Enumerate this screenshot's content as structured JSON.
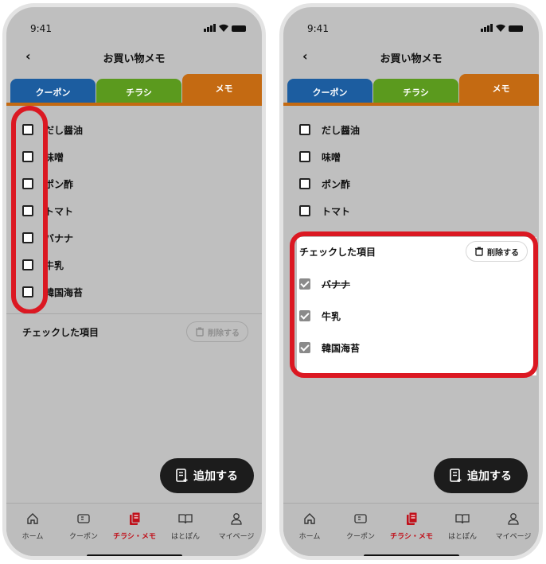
{
  "status": {
    "time": "9:41"
  },
  "nav": {
    "back": "‹",
    "title": "お買い物メモ"
  },
  "tabs": {
    "coupon": "クーポン",
    "flyer": "チラシ",
    "memo": "メモ"
  },
  "left": {
    "items": [
      {
        "label": "だし醤油",
        "checked": false
      },
      {
        "label": "味噌",
        "checked": false
      },
      {
        "label": "ポン酢",
        "checked": false
      },
      {
        "label": "トマト",
        "checked": false
      },
      {
        "label": "バナナ",
        "checked": false
      },
      {
        "label": "牛乳",
        "checked": false
      },
      {
        "label": "韓国海苔",
        "checked": false
      }
    ],
    "checked_section_title": "チェックした項目",
    "delete_label": "削除する"
  },
  "right": {
    "items": [
      {
        "label": "だし醤油",
        "checked": false
      },
      {
        "label": "味噌",
        "checked": false
      },
      {
        "label": "ポン酢",
        "checked": false
      },
      {
        "label": "トマト",
        "checked": false
      }
    ],
    "checked_section_title": "チェックした項目",
    "delete_label": "削除する",
    "checked_items": [
      {
        "label": "バナナ",
        "strikethrough": true
      },
      {
        "label": "牛乳",
        "strikethrough": false
      },
      {
        "label": "韓国海苔",
        "strikethrough": false
      }
    ]
  },
  "fab": {
    "label": "追加する"
  },
  "bottom_nav": [
    {
      "label": "ホーム",
      "icon": "home-icon",
      "active": false
    },
    {
      "label": "クーポン",
      "icon": "coupon-icon",
      "active": false
    },
    {
      "label": "チラシ・メモ",
      "icon": "flyer-memo-icon",
      "active": true
    },
    {
      "label": "はとぽん",
      "icon": "book-icon",
      "active": false
    },
    {
      "label": "マイページ",
      "icon": "person-icon",
      "active": false
    }
  ],
  "colors": {
    "coupon_tab": "#1c5da0",
    "flyer_tab": "#5b9a1e",
    "memo_tab": "#c46a12",
    "highlight": "#db1822",
    "active_nav": "#c0101a"
  }
}
